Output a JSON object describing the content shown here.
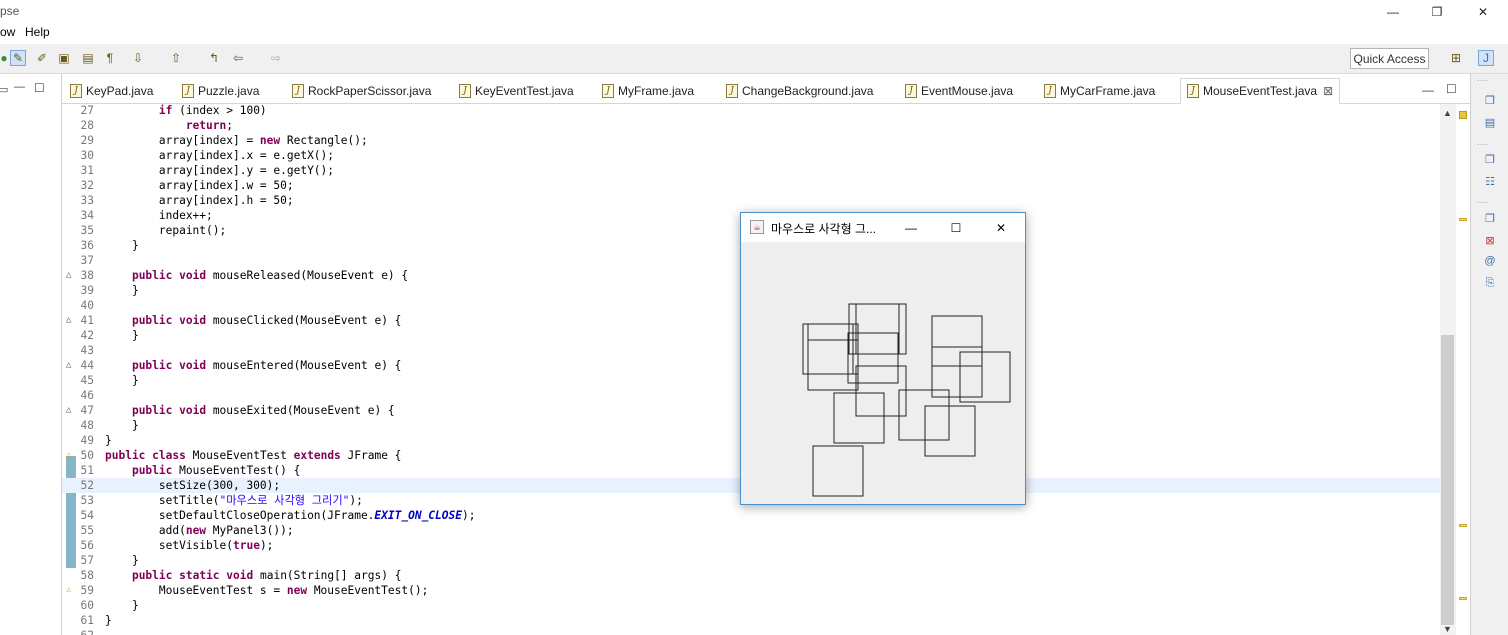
{
  "app": {
    "title": "pse"
  },
  "window_controls": {
    "minimize": "—",
    "restore": "❐",
    "close": "✕"
  },
  "menu": {
    "items": [
      "ow",
      "Help"
    ]
  },
  "toolbar": {
    "quick_access": "Quick Access"
  },
  "tabs": [
    {
      "label": "KeyPad.java",
      "active": false
    },
    {
      "label": "Puzzle.java",
      "active": false
    },
    {
      "label": "RockPaperScissor.java",
      "active": false
    },
    {
      "label": "KeyEventTest.java",
      "active": false
    },
    {
      "label": "MyFrame.java",
      "active": false
    },
    {
      "label": "ChangeBackground.java",
      "active": false
    },
    {
      "label": "EventMouse.java",
      "active": false
    },
    {
      "label": "MyCarFrame.java",
      "active": false
    },
    {
      "label": "MouseEventTest.java",
      "active": true,
      "close": "⊠"
    }
  ],
  "editor": {
    "lines": [
      {
        "num": "27",
        "text": "        if (index > 100)"
      },
      {
        "num": "28",
        "text": "            return;"
      },
      {
        "num": "29",
        "text": "        array[index] = new Rectangle();"
      },
      {
        "num": "30",
        "text": "        array[index].x = e.getX();"
      },
      {
        "num": "31",
        "text": "        array[index].y = e.getY();"
      },
      {
        "num": "32",
        "text": "        array[index].w = 50;"
      },
      {
        "num": "33",
        "text": "        array[index].h = 50;"
      },
      {
        "num": "34",
        "text": "        index++;"
      },
      {
        "num": "35",
        "text": "        repaint();"
      },
      {
        "num": "36",
        "text": "    }"
      },
      {
        "num": "37",
        "text": ""
      },
      {
        "num": "38",
        "text": "    public void mouseReleased(MouseEvent e) {"
      },
      {
        "num": "39",
        "text": "    }"
      },
      {
        "num": "40",
        "text": ""
      },
      {
        "num": "41",
        "text": "    public void mouseClicked(MouseEvent e) {"
      },
      {
        "num": "42",
        "text": "    }"
      },
      {
        "num": "43",
        "text": ""
      },
      {
        "num": "44",
        "text": "    public void mouseEntered(MouseEvent e) {"
      },
      {
        "num": "45",
        "text": "    }"
      },
      {
        "num": "46",
        "text": ""
      },
      {
        "num": "47",
        "text": "    public void mouseExited(MouseEvent e) {"
      },
      {
        "num": "48",
        "text": "    }"
      },
      {
        "num": "49",
        "text": "}"
      },
      {
        "num": "50",
        "text": "public class MouseEventTest extends JFrame {"
      },
      {
        "num": "51",
        "text": "    public MouseEventTest() {"
      },
      {
        "num": "52",
        "text": "        setSize(300, 300);"
      },
      {
        "num": "53",
        "text": "        setTitle(\"마우스로 사각형 그리기\");"
      },
      {
        "num": "54",
        "text": "        setDefaultCloseOperation(JFrame.EXIT_ON_CLOSE);"
      },
      {
        "num": "55",
        "text": "        add(new MyPanel3());"
      },
      {
        "num": "56",
        "text": "        setVisible(true);"
      },
      {
        "num": "57",
        "text": "    }"
      },
      {
        "num": "58",
        "text": "    public static void main(String[] args) {"
      },
      {
        "num": "59",
        "text": "        MouseEventTest s = new MouseEventTest();"
      },
      {
        "num": "60",
        "text": "    }"
      },
      {
        "num": "61",
        "text": "}"
      },
      {
        "num": "62",
        "text": ""
      }
    ]
  },
  "java_window": {
    "title": "마우스로 사각형 그...",
    "buttons": {
      "minimize": "—",
      "maximize": "☐",
      "close": "✕"
    },
    "rectangles_count": 14
  },
  "colors": {
    "keyword": "#7f0055",
    "string": "#2a00ff",
    "constant": "#0000c0",
    "current_line": "#e8f2fe",
    "window_border": "#4a8fd0"
  }
}
